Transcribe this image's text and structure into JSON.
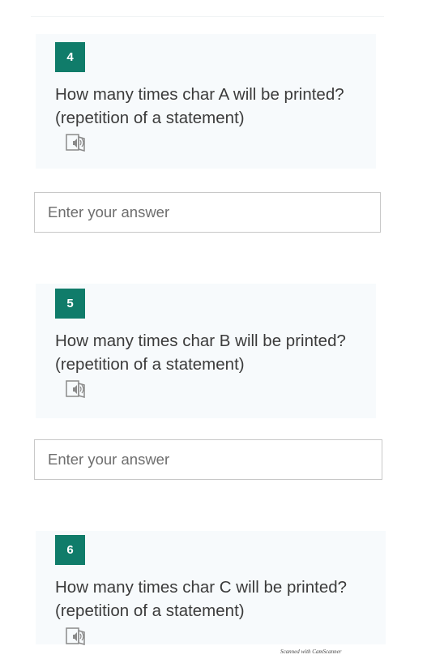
{
  "questions": [
    {
      "number": "4",
      "text": "How many times char A will be printed? (repetition of a statement)",
      "read_icon": "immersive-reader-icon",
      "answer_placeholder": "Enter your answer"
    },
    {
      "number": "5",
      "text": "How many times char B will be printed? (repetition of a statement)",
      "read_icon": "immersive-reader-icon",
      "answer_placeholder": "Enter your answer"
    },
    {
      "number": "6",
      "text": "How many times char C will be printed? (repetition of a statement)",
      "read_icon": "immersive-reader-icon"
    }
  ],
  "footer": {
    "scan_note": "Scanned with CamScanner"
  },
  "colors": {
    "accent": "#107c6a",
    "card_background": "#f7fafc",
    "input_border": "#c8c8c8"
  }
}
